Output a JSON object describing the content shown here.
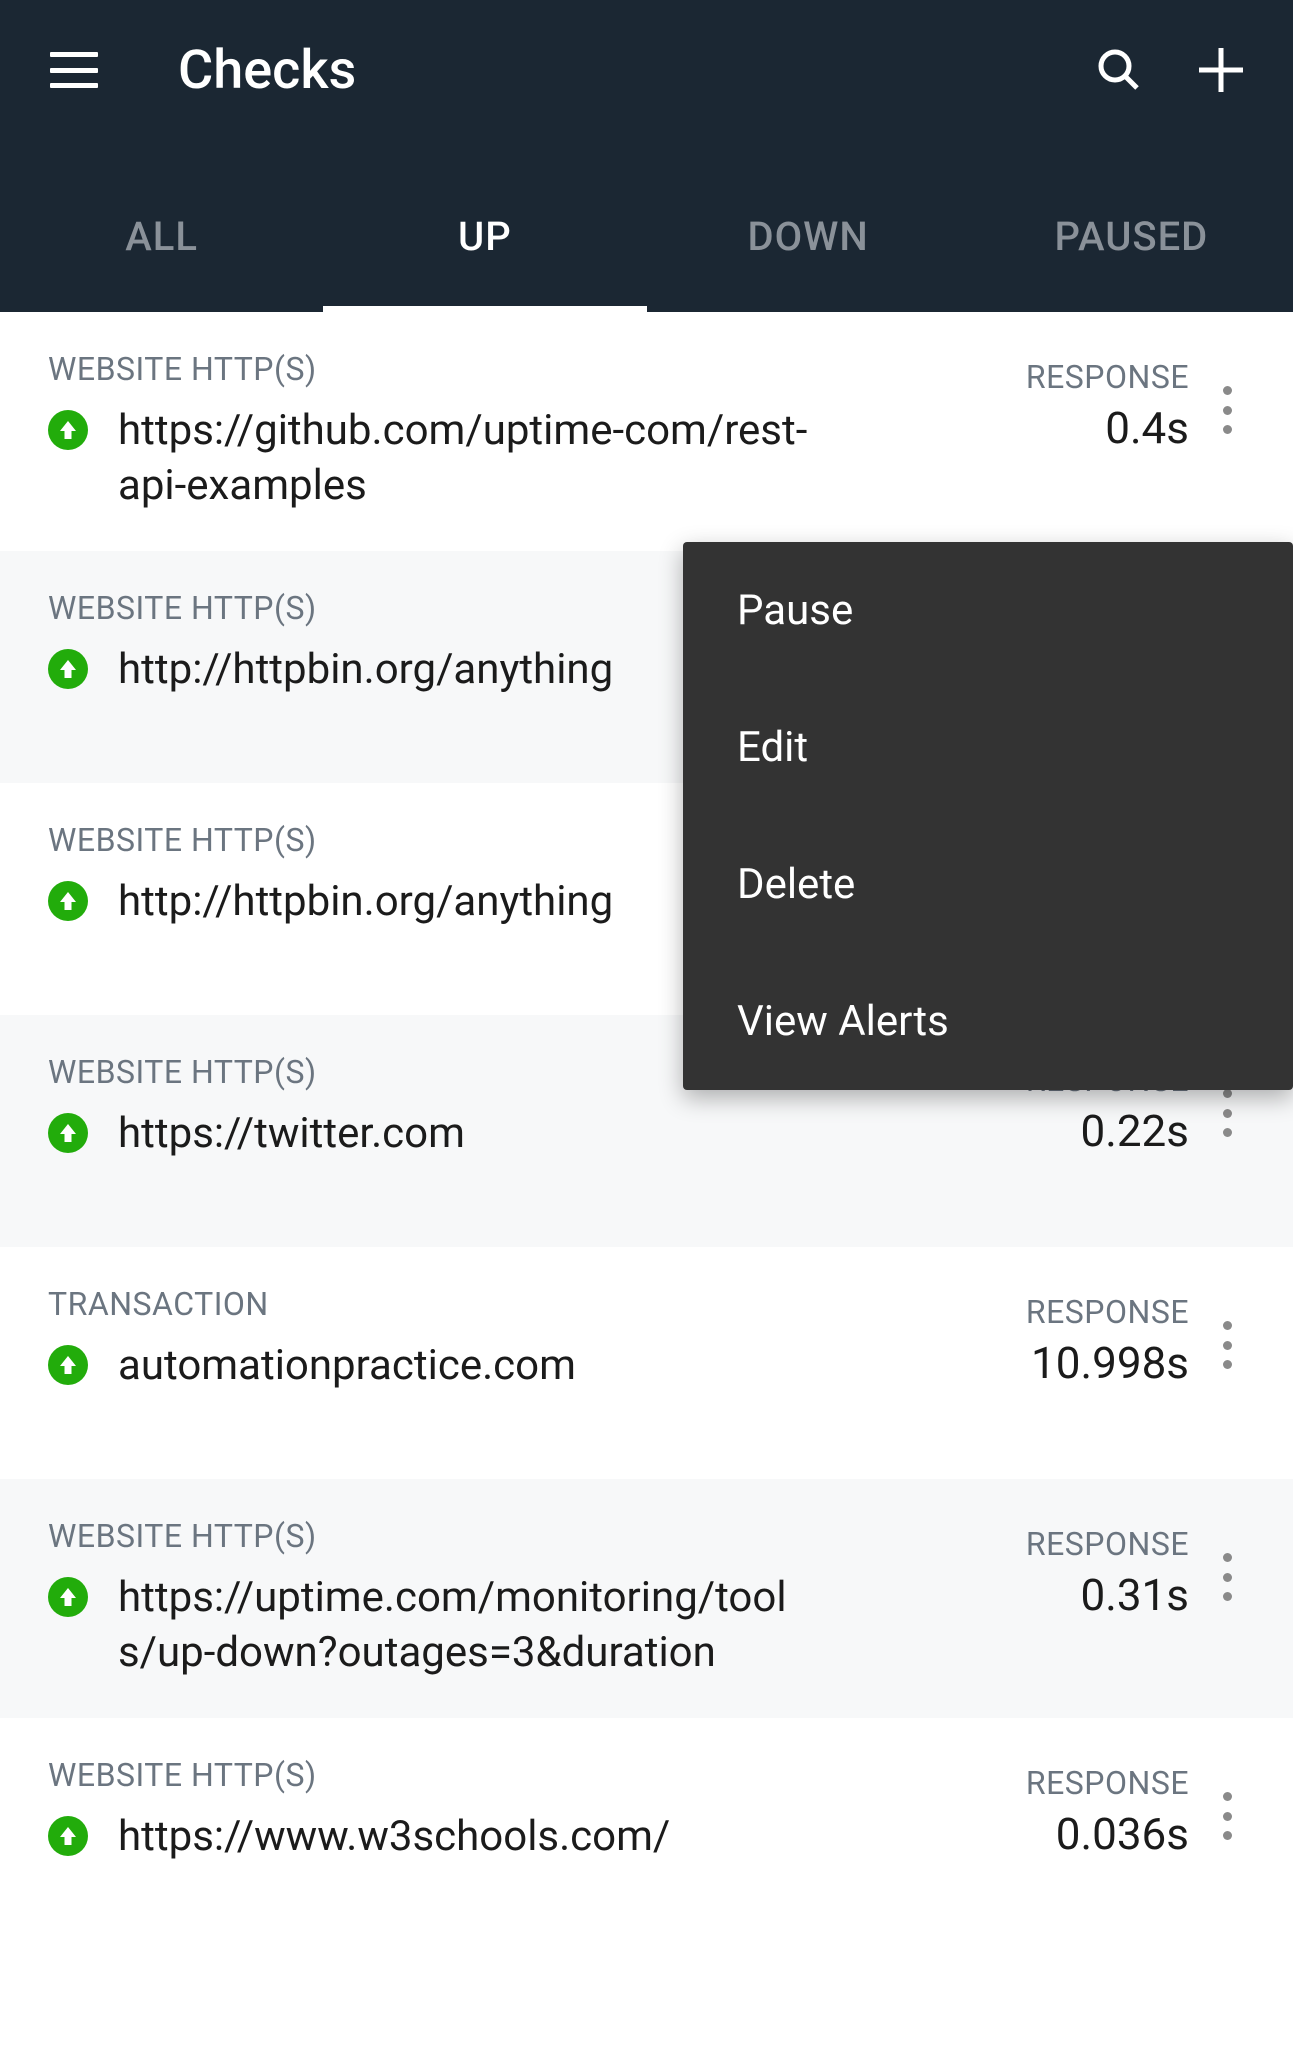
{
  "header": {
    "title": "Checks"
  },
  "tabs": [
    {
      "label": "ALL",
      "active": false
    },
    {
      "label": "UP",
      "active": true
    },
    {
      "label": "DOWN",
      "active": false
    },
    {
      "label": "PAUSED",
      "active": false
    }
  ],
  "checks": [
    {
      "type": "WEBSITE HTTP(S)",
      "url": "https://github.com/uptime-com/rest-api-examples",
      "status": "up",
      "response_label": "RESPONSE",
      "response_value": "0.4s"
    },
    {
      "type": "WEBSITE HTTP(S)",
      "url": "http://httpbin.org/anything",
      "status": "up",
      "response_label": "",
      "response_value": ""
    },
    {
      "type": "WEBSITE HTTP(S)",
      "url": "http://httpbin.org/anything",
      "status": "up",
      "response_label": "",
      "response_value": ""
    },
    {
      "type": "WEBSITE HTTP(S)",
      "url": "https://twitter.com",
      "status": "up",
      "response_label": "RESPONSE",
      "response_value": "0.22s"
    },
    {
      "type": "TRANSACTION",
      "url": "automationpractice.com",
      "status": "up",
      "response_label": "RESPONSE",
      "response_value": "10.998s"
    },
    {
      "type": "WEBSITE HTTP(S)",
      "url": "https://uptime.com/monitoring/tools/up-down?outages=3&duration",
      "status": "up",
      "response_label": "RESPONSE",
      "response_value": "0.31s"
    },
    {
      "type": "WEBSITE HTTP(S)",
      "url": "https://www.w3schools.com/",
      "status": "up",
      "response_label": "RESPONSE",
      "response_value": "0.036s"
    }
  ],
  "context_menu": {
    "items": [
      {
        "label": "Pause"
      },
      {
        "label": "Edit"
      },
      {
        "label": "Delete"
      },
      {
        "label": "View Alerts"
      }
    ]
  }
}
